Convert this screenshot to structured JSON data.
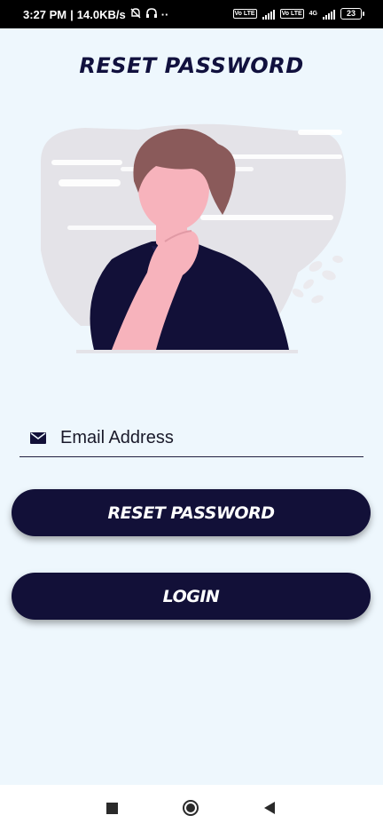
{
  "status_bar": {
    "time": "3:27 PM",
    "separator": "|",
    "speed": "14.0KB/s",
    "dots": "··",
    "sim1_tag": "Vo LTE",
    "sim2_tag": "Vo LTE",
    "network": "4G",
    "battery": "23"
  },
  "screen": {
    "title": "RESET PASSWORD"
  },
  "form": {
    "email_placeholder": "Email Address",
    "email_value": ""
  },
  "buttons": {
    "reset_label": "RESET PASSWORD",
    "login_label": "LOGIN"
  },
  "colors": {
    "background": "#eef7fd",
    "primary": "#121038",
    "title": "#11113e",
    "hair": "#8a5a5a",
    "skin": "#f7b3bc",
    "shirt": "#121038",
    "cloud": "#e4e3e8"
  },
  "icons": {
    "email": "mail-icon",
    "nav_recent": "square-icon",
    "nav_home": "circle-icon",
    "nav_back": "triangle-back-icon"
  }
}
